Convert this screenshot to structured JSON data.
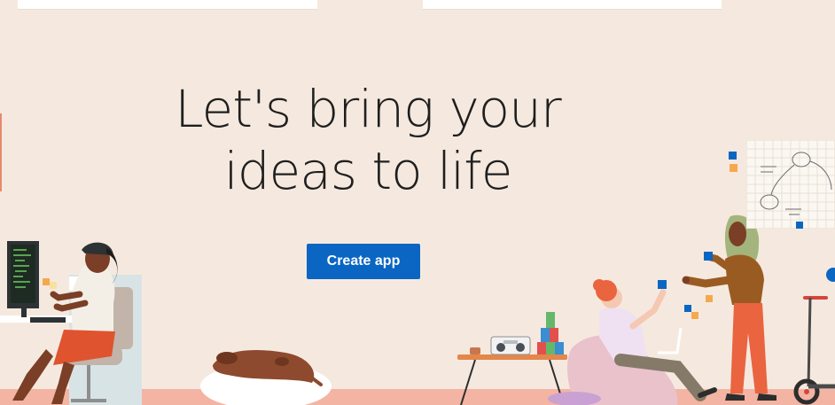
{
  "hero": {
    "headline_line1": "Let's bring your",
    "headline_line2": "ideas to life",
    "cta_label": "Create app"
  },
  "colors": {
    "background": "#f5e9df",
    "cta": "#0a66c2",
    "floor": "#f4b4a3"
  },
  "illustrations": [
    "developer-at-desk",
    "dog-on-cushion",
    "side-table-with-radio",
    "person-on-beanbag",
    "person-with-sticky-notes",
    "whiteboard",
    "scooter"
  ]
}
